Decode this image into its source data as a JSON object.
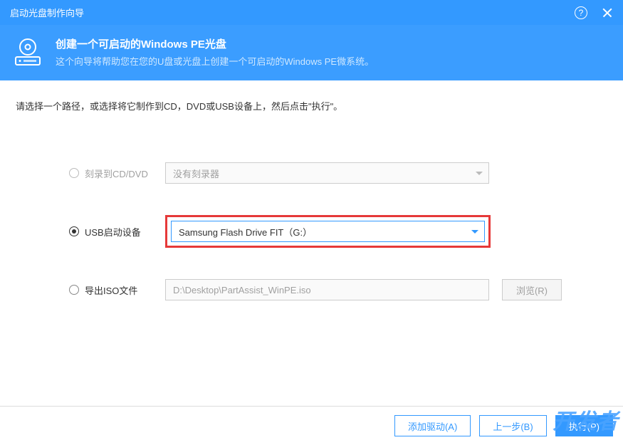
{
  "titlebar": {
    "title": "启动光盘制作向导"
  },
  "header": {
    "title": "创建一个可启动的Windows PE光盘",
    "subtitle": "这个向导将帮助您在您的U盘或光盘上创建一个可启动的Windows PE微系统。"
  },
  "instruction": "请选择一个路径，或选择将它制作到CD，DVD或USB设备上，然后点击\"执行\"。",
  "options": {
    "cd": {
      "label": "刻录到CD/DVD",
      "value": "没有刻录器",
      "checked": false,
      "enabled": false
    },
    "usb": {
      "label": "USB启动设备",
      "value": "Samsung Flash Drive FIT（G:）",
      "checked": true,
      "enabled": true
    },
    "iso": {
      "label": "导出ISO文件",
      "value": "D:\\Desktop\\PartAssist_WinPE.iso",
      "checked": false,
      "browse_label": "浏览(R)"
    }
  },
  "footer": {
    "add_driver": "添加驱动(A)",
    "back": "上一步(B)",
    "execute": "执行(P)"
  },
  "watermark": "开发者"
}
